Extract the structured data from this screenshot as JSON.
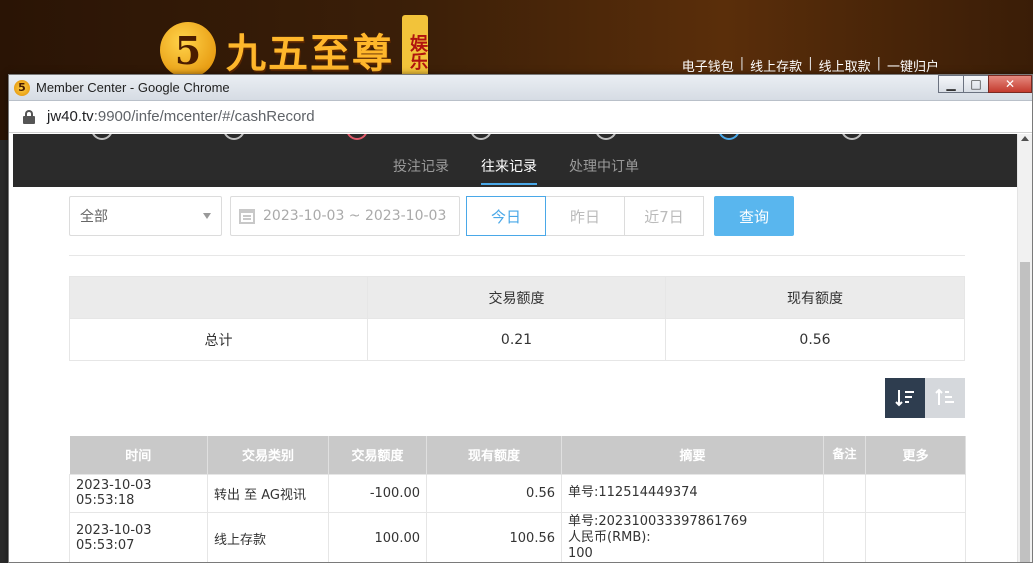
{
  "background": {
    "logo_mark": "5",
    "logo_text": "九五至尊",
    "logo_badge": "娱乐",
    "top_links": [
      "电子钱包",
      "线上存款",
      "线上取款",
      "一键归户"
    ],
    "link_separator": "|"
  },
  "window": {
    "title": "Member Center - Google Chrome",
    "controls": {
      "minimize": "▁",
      "maximize": "□",
      "close": "✕"
    }
  },
  "address_bar": {
    "host": "jw40.tv",
    "path": ":9900/infe/mcenter/#/cashRecord"
  },
  "subnav": {
    "tabs": [
      {
        "label": "投注记录",
        "active": false
      },
      {
        "label": "往来记录",
        "active": true
      },
      {
        "label": "处理中订单",
        "active": false
      }
    ]
  },
  "filter": {
    "type_select": "全部",
    "date_range": "2023-10-03 ~ 2023-10-03",
    "quick_ranges": [
      {
        "label": "今日",
        "active": true
      },
      {
        "label": "昨日",
        "active": false
      },
      {
        "label": "近7日",
        "active": false
      }
    ],
    "search_label": "查询"
  },
  "summary": {
    "headers": [
      "",
      "交易额度",
      "现有额度"
    ],
    "row": [
      "总计",
      "0.21",
      "0.56"
    ]
  },
  "records": {
    "headers": [
      "时间",
      "交易类别",
      "交易额度",
      "现有额度",
      "摘要",
      "备注",
      "更多"
    ],
    "rows": [
      {
        "time": "2023-10-03 05:53:18",
        "category": "转出 至 AG视讯",
        "amount": "-100.00",
        "balance": "0.56",
        "summary_lines": [
          "单号:112514449374"
        ],
        "note": "",
        "more": ""
      },
      {
        "time": "2023-10-03 05:53:07",
        "category": "线上存款",
        "amount": "100.00",
        "balance": "100.56",
        "summary_lines": [
          "单号:202310033397861769",
          "人民币(RMB):",
          "100"
        ],
        "note": "",
        "more": ""
      }
    ]
  },
  "colors": {
    "accent": "#4aa8e8",
    "search_button": "#59b6ee",
    "dark_nav": "#2b2b2b",
    "sort_active": "#2e3d4f"
  }
}
